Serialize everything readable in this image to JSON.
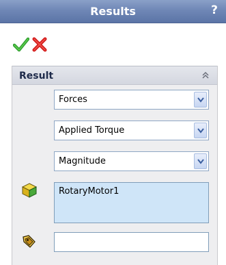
{
  "window": {
    "title": "Results",
    "help_label": "?"
  },
  "actions": {
    "ok_icon": "checkmark-icon",
    "cancel_icon": "close-icon"
  },
  "result_section": {
    "label": "Result",
    "collapse_icon": "chevron-double-up-icon",
    "selects": [
      {
        "value": "Forces"
      },
      {
        "value": "Applied Torque"
      },
      {
        "value": "Magnitude"
      }
    ],
    "component_list": {
      "icon": "part-cube-icon",
      "items": [
        "RotaryMotor1"
      ]
    },
    "reference_field": {
      "icon": "reference-component-icon",
      "value": ""
    }
  },
  "colors": {
    "title_bar": "#6f87b6",
    "panel_bg": "#eeeef0",
    "selection_bg": "#cfe5f8",
    "ok_green": "#2f9e2f",
    "cancel_red": "#d21a1a"
  }
}
